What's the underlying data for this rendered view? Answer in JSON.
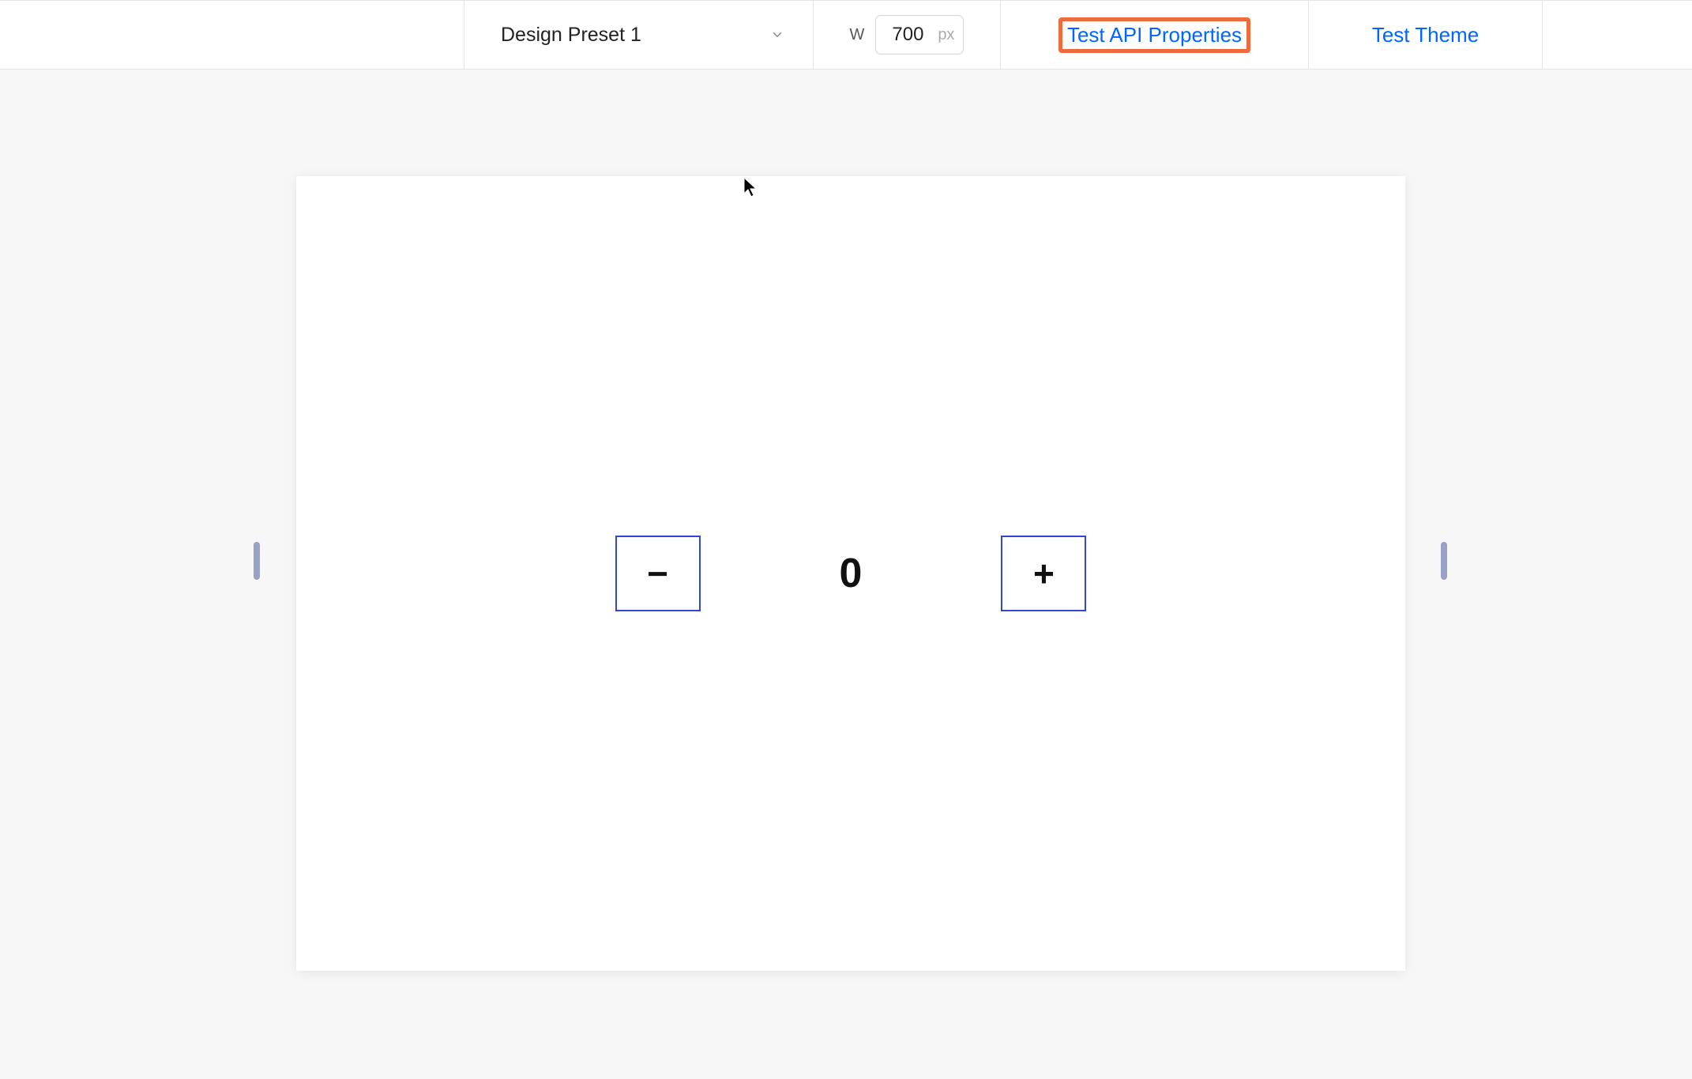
{
  "toolbar": {
    "preset_label": "Design Preset 1",
    "width_label": "W",
    "width_value": "700",
    "width_unit": "px",
    "api_link": "Test API Properties",
    "theme_link": "Test Theme"
  },
  "counter": {
    "decrement_label": "−",
    "value": "0",
    "increment_label": "+"
  }
}
